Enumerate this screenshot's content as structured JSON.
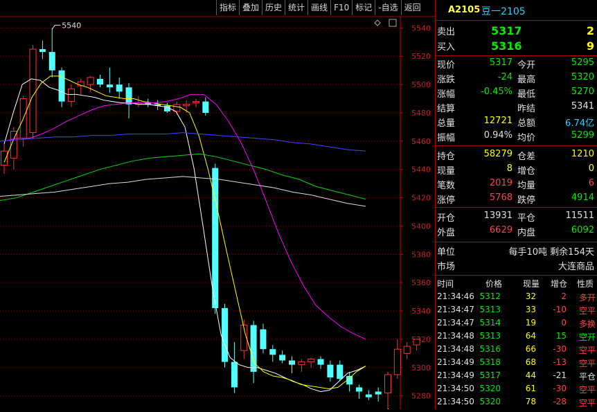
{
  "toolbar": [
    "指标",
    "叠加",
    "历史",
    "统计",
    "画线",
    "F10",
    "标记",
    "-自选",
    "返回"
  ],
  "instrument": {
    "code": "A2105",
    "name": "豆一2105"
  },
  "orderbook": [
    {
      "label": "卖出",
      "price": "5317",
      "vol": "2"
    },
    {
      "label": "买入",
      "price": "5316",
      "vol": "9"
    }
  ],
  "quote": [
    {
      "l1": "现价",
      "v1": "5317",
      "c1": "green",
      "l2": "今开",
      "v2": "5295",
      "c2": "green"
    },
    {
      "l1": "涨跌",
      "v1": "-24",
      "c1": "green",
      "l2": "最高",
      "v2": "5320",
      "c2": "green"
    },
    {
      "l1": "涨幅",
      "v1": "-0.45%",
      "c1": "green",
      "l2": "最低",
      "v2": "5270",
      "c2": "green"
    },
    {
      "l1": "结算",
      "v1": "",
      "c1": "white",
      "l2": "昨结",
      "v2": "5341",
      "c2": "white"
    },
    {
      "l1": "总量",
      "v1": "12721",
      "c1": "yellow",
      "l2": "总额",
      "v2": "6.74亿",
      "c2": "cyan"
    },
    {
      "l1": "振幅",
      "v1": "0.94%",
      "c1": "white",
      "l2": "均价",
      "v2": "5299",
      "c2": "green"
    }
  ],
  "position": [
    {
      "l1": "持仓",
      "v1": "58279",
      "c1": "yellow",
      "l2": "仓差",
      "v2": "1210",
      "c2": "yellow"
    },
    {
      "l1": "现量",
      "v1": "8",
      "c1": "yellow",
      "l2": "增仓",
      "v2": "0",
      "c2": "yellow"
    },
    {
      "l1": "笔数",
      "v1": "2019",
      "c1": "red",
      "l2": "均量",
      "v2": "6",
      "c2": "red"
    },
    {
      "l1": "涨停",
      "v1": "5768",
      "c1": "red",
      "l2": "跌停",
      "v2": "4914",
      "c2": "green"
    }
  ],
  "openclose": [
    {
      "l1": "开仓",
      "v1": "13931",
      "c1": "white",
      "l2": "平仓",
      "v2": "11511",
      "c2": "white"
    },
    {
      "l1": "外盘",
      "v1": "6629",
      "c1": "red",
      "l2": "内盘",
      "v2": "6092",
      "c2": "green"
    }
  ],
  "info": [
    {
      "label": "单位",
      "value": "每手10吨  剩余154天"
    },
    {
      "label": "市场",
      "value": "大连商品"
    }
  ],
  "trades_header": [
    "时间",
    "价格",
    "现量",
    "增仓",
    "性质"
  ],
  "trades": [
    {
      "time": "21:34:46",
      "price": "5312",
      "vol": "32",
      "oi": "2",
      "oi_c": "red",
      "nature": "多开",
      "n_c": "red"
    },
    {
      "time": "21:34:47",
      "price": "5313",
      "vol": "33",
      "oi": "-10",
      "oi_c": "red",
      "nature": "空平",
      "n_c": "red"
    },
    {
      "time": "21:34:47",
      "price": "5314",
      "vol": "19",
      "oi": "0",
      "oi_c": "red",
      "nature": "多换",
      "n_c": "red"
    },
    {
      "time": "21:34:48",
      "price": "5313",
      "vol": "64",
      "oi": "15",
      "oi_c": "green",
      "nature": "空开",
      "n_c": "green"
    },
    {
      "time": "21:34:48",
      "price": "5316",
      "vol": "66",
      "oi": "-30",
      "oi_c": "red",
      "nature": "空平",
      "n_c": "red"
    },
    {
      "time": "21:34:49",
      "price": "5318",
      "vol": "68",
      "oi": "-13",
      "oi_c": "red",
      "nature": "空平",
      "n_c": "red"
    },
    {
      "time": "21:34:49",
      "price": "5317",
      "vol": "44",
      "oi": "-21",
      "oi_c": "white",
      "nature": "平仓",
      "n_c": "white"
    },
    {
      "time": "21:34:50",
      "price": "5320",
      "vol": "61",
      "oi": "-30",
      "oi_c": "red",
      "nature": "空平",
      "n_c": "red"
    },
    {
      "time": "21:34:50",
      "price": "5320",
      "vol": "78",
      "oi": "-28",
      "oi_c": "red",
      "nature": "空平",
      "n_c": "red"
    }
  ],
  "colors": {
    "up": "#ff3333",
    "down": "#54ffff",
    "grid": "#8b0000",
    "axis": "#cc0000"
  },
  "chart_data": {
    "type": "candlestick",
    "ylim": [
      5270,
      5545
    ],
    "yticks": [
      5280,
      5300,
      5320,
      5340,
      5360,
      5380,
      5400,
      5420,
      5440,
      5460,
      5480,
      5500,
      5520,
      5540
    ],
    "candles": [
      {
        "o": 5443,
        "h": 5458,
        "l": 5437,
        "c": 5453
      },
      {
        "o": 5448,
        "h": 5470,
        "l": 5440,
        "c": 5467
      },
      {
        "o": 5462,
        "h": 5492,
        "l": 5456,
        "c": 5490
      },
      {
        "o": 5466,
        "h": 5528,
        "l": 5462,
        "c": 5525
      },
      {
        "o": 5525,
        "h": 5531,
        "l": 5518,
        "c": 5523
      },
      {
        "o": 5523,
        "h": 5540,
        "l": 5505,
        "c": 5510
      },
      {
        "o": 5510,
        "h": 5512,
        "l": 5484,
        "c": 5488
      },
      {
        "o": 5488,
        "h": 5500,
        "l": 5484,
        "c": 5497
      },
      {
        "o": 5499,
        "h": 5504,
        "l": 5493,
        "c": 5502
      },
      {
        "o": 5500,
        "h": 5506,
        "l": 5495,
        "c": 5505
      },
      {
        "o": 5504,
        "h": 5507,
        "l": 5498,
        "c": 5500
      },
      {
        "o": 5500,
        "h": 5512,
        "l": 5494,
        "c": 5498
      },
      {
        "o": 5500,
        "h": 5505,
        "l": 5490,
        "c": 5495
      },
      {
        "o": 5498,
        "h": 5501,
        "l": 5476,
        "c": 5486
      },
      {
        "o": 5486,
        "h": 5492,
        "l": 5484,
        "c": 5487
      },
      {
        "o": 5487,
        "h": 5490,
        "l": 5484,
        "c": 5486
      },
      {
        "o": 5486,
        "h": 5489,
        "l": 5482,
        "c": 5485
      },
      {
        "o": 5485,
        "h": 5487,
        "l": 5480,
        "c": 5481
      },
      {
        "o": 5481,
        "h": 5488,
        "l": 5479,
        "c": 5486
      },
      {
        "o": 5485,
        "h": 5489,
        "l": 5480,
        "c": 5486
      },
      {
        "o": 5487,
        "h": 5490,
        "l": 5484,
        "c": 5488
      },
      {
        "o": 5488,
        "h": 5491,
        "l": 5478,
        "c": 5480
      },
      {
        "o": 5441,
        "h": 5444,
        "l": 5338,
        "c": 5342
      },
      {
        "o": 5342,
        "h": 5345,
        "l": 5300,
        "c": 5304
      },
      {
        "o": 5304,
        "h": 5318,
        "l": 5282,
        "c": 5286
      },
      {
        "o": 5312,
        "h": 5334,
        "l": 5306,
        "c": 5330
      },
      {
        "o": 5330,
        "h": 5333,
        "l": 5289,
        "c": 5297
      },
      {
        "o": 5327,
        "h": 5331,
        "l": 5310,
        "c": 5313
      },
      {
        "o": 5313,
        "h": 5316,
        "l": 5304,
        "c": 5309
      },
      {
        "o": 5309,
        "h": 5312,
        "l": 5303,
        "c": 5305
      },
      {
        "o": 5305,
        "h": 5308,
        "l": 5296,
        "c": 5302
      },
      {
        "o": 5302,
        "h": 5306,
        "l": 5297,
        "c": 5304
      },
      {
        "o": 5304,
        "h": 5307,
        "l": 5300,
        "c": 5306
      },
      {
        "o": 5306,
        "h": 5308,
        "l": 5299,
        "c": 5302
      },
      {
        "o": 5302,
        "h": 5305,
        "l": 5290,
        "c": 5293
      },
      {
        "o": 5302,
        "h": 5305,
        "l": 5291,
        "c": 5292
      },
      {
        "o": 5294,
        "h": 5297,
        "l": 5283,
        "c": 5288
      },
      {
        "o": 5286,
        "h": 5288,
        "l": 5278,
        "c": 5283
      },
      {
        "o": 5281,
        "h": 5284,
        "l": 5277,
        "c": 5279
      },
      {
        "o": 5283,
        "h": 5286,
        "l": 5276,
        "c": 5281
      },
      {
        "o": 5282,
        "h": 5297,
        "l": 5270,
        "c": 5295
      },
      {
        "o": 5295,
        "h": 5320,
        "l": 5292,
        "c": 5313
      },
      {
        "o": 5310,
        "h": 5318,
        "l": 5306,
        "c": 5315
      },
      {
        "o": 5316,
        "h": 5320,
        "l": 5312,
        "c": 5320
      }
    ],
    "annotations": [
      {
        "label": "5540",
        "value": 5540
      },
      {
        "label": "5270",
        "value": 5270
      }
    ],
    "ma_lines": [
      {
        "color": "#ffffff",
        "points": [
          5458,
          5480,
          5500,
          5504,
          5503,
          5498,
          5496,
          5493,
          5493,
          5492,
          5491,
          5489,
          5488,
          5487,
          5487,
          5486,
          5486,
          5485,
          5484,
          5481,
          5470,
          5441,
          5400,
          5358,
          5323,
          5307,
          5302,
          5300,
          5300,
          5298,
          5296,
          5293,
          5290,
          5288,
          5285,
          5283,
          5284,
          5290,
          5296,
          5298,
          5301
        ]
      },
      {
        "color": "#ffff00",
        "points": [
          5445,
          5461,
          5475,
          5491,
          5501,
          5506,
          5506,
          5503,
          5500,
          5498,
          5495,
          5492,
          5491,
          5490,
          5490,
          5488,
          5487,
          5486,
          5485,
          5484,
          5480,
          5464,
          5440,
          5412,
          5382,
          5353,
          5324,
          5303,
          5297,
          5294,
          5293,
          5291,
          5288,
          5287,
          5286,
          5285,
          5286,
          5291,
          5297,
          5301
        ]
      },
      {
        "color": "#ff00ff",
        "points": [
          5460,
          5462,
          5462,
          5465,
          5469,
          5474,
          5478,
          5482,
          5485,
          5486,
          5487,
          5487,
          5487,
          5488,
          5490,
          5493,
          5493,
          5486,
          5474,
          5459,
          5440,
          5418,
          5395,
          5375,
          5358,
          5344,
          5336,
          5329,
          5324,
          5320
        ]
      },
      {
        "color": "#00dd00",
        "points": [
          5418,
          5420,
          5424,
          5428,
          5432,
          5436,
          5440,
          5443,
          5446,
          5448,
          5449,
          5450,
          5451,
          5449,
          5446,
          5443,
          5440,
          5436,
          5433,
          5428,
          5425,
          5422,
          5419
        ]
      },
      {
        "color": "#4444ff",
        "points": [
          5460,
          5461,
          5462,
          5463,
          5463,
          5464,
          5464,
          5465,
          5465,
          5465,
          5466,
          5465,
          5464,
          5463,
          5462,
          5461,
          5459,
          5458,
          5456,
          5454,
          5453
        ]
      },
      {
        "color": "#dddddd",
        "points": [
          5421,
          5422,
          5423,
          5424,
          5426,
          5428,
          5430,
          5431,
          5433,
          5434,
          5435,
          5434,
          5433,
          5431,
          5429,
          5427,
          5424,
          5422,
          5419,
          5416,
          5414
        ]
      }
    ]
  }
}
